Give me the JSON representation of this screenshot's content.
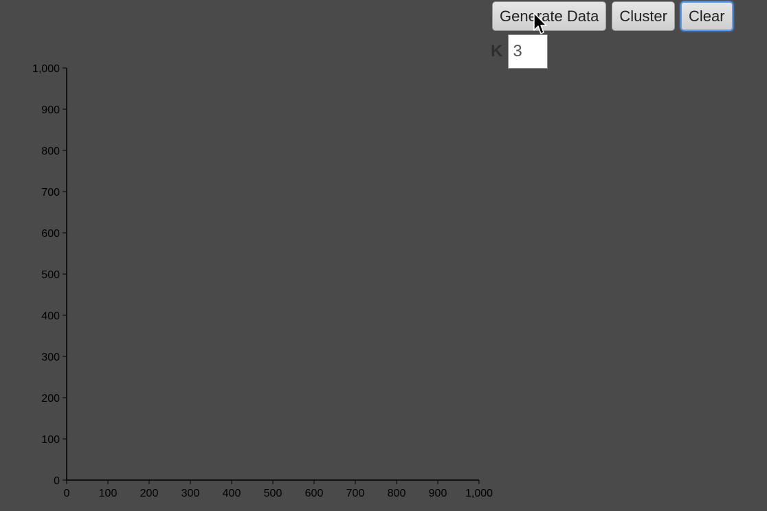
{
  "toolbar": {
    "generate_label": "Generate Data",
    "cluster_label": "Cluster",
    "clear_label": "Clear"
  },
  "k_control": {
    "label": "K",
    "value": "3"
  },
  "chart_data": {
    "type": "scatter",
    "x": [],
    "y": [],
    "xlim": [
      0,
      1000
    ],
    "ylim": [
      0,
      1000
    ],
    "x_ticks": [
      "0",
      "100",
      "200",
      "300",
      "400",
      "500",
      "600",
      "700",
      "800",
      "900",
      "1,000"
    ],
    "y_ticks": [
      "0",
      "100",
      "200",
      "300",
      "400",
      "500",
      "600",
      "700",
      "800",
      "900",
      "1,000"
    ],
    "grid": false
  }
}
